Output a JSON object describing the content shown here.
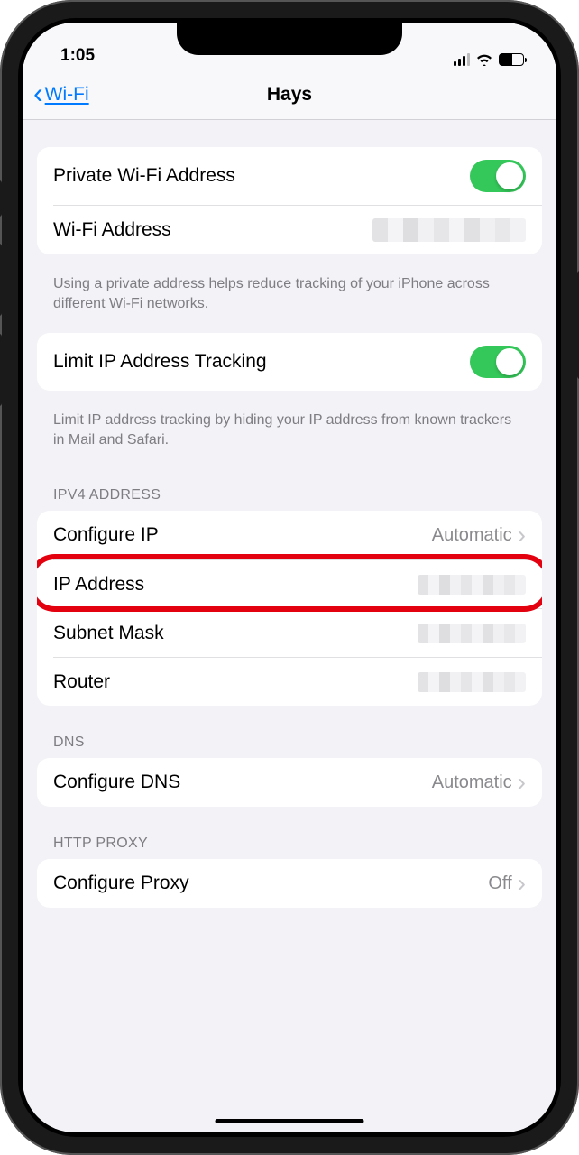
{
  "status": {
    "time": "1:05"
  },
  "nav": {
    "back_label": "Wi-Fi",
    "title": "Hays"
  },
  "section_private": {
    "row_private_label": "Private Wi-Fi Address",
    "row_address_label": "Wi-Fi Address",
    "footer": "Using a private address helps reduce tracking of your iPhone across different Wi-Fi networks."
  },
  "section_limit": {
    "row_label": "Limit IP Address Tracking",
    "footer": "Limit IP address tracking by hiding your IP address from known trackers in Mail and Safari."
  },
  "section_ipv4": {
    "header": "IPV4 ADDRESS",
    "configure_label": "Configure IP",
    "configure_value": "Automatic",
    "ip_label": "IP Address",
    "subnet_label": "Subnet Mask",
    "router_label": "Router"
  },
  "section_dns": {
    "header": "DNS",
    "configure_label": "Configure DNS",
    "configure_value": "Automatic"
  },
  "section_proxy": {
    "header": "HTTP PROXY",
    "configure_label": "Configure Proxy",
    "configure_value": "Off"
  }
}
